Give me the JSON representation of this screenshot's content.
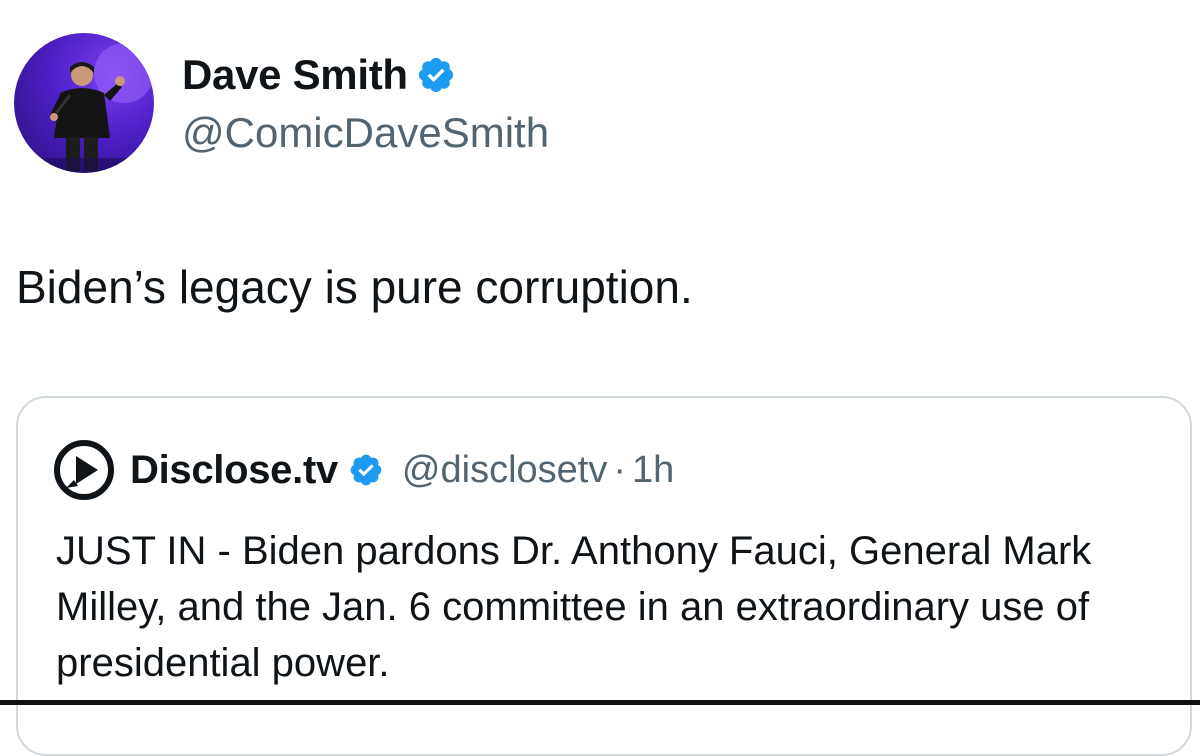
{
  "author": {
    "display_name": "Dave Smith",
    "handle": "@ComicDaveSmith",
    "verified": true,
    "avatar_icon": "comedian-on-stage-avatar"
  },
  "tweet": {
    "text": "Biden’s legacy is pure corruption."
  },
  "quoted_tweet": {
    "display_name": "Disclose.tv",
    "handle": "@disclosetv",
    "separator": "·",
    "time": "1h",
    "verified": true,
    "logo_icon": "disclose-tv-logo",
    "text": "JUST IN - Biden pardons Dr. Anthony Fauci, General Mark Milley, and the Jan. 6 committee in an extraordinary use of presidential power."
  },
  "colors": {
    "verified_blue": "#1d9bf0",
    "secondary_text": "#536471",
    "border": "#cfd9de"
  }
}
